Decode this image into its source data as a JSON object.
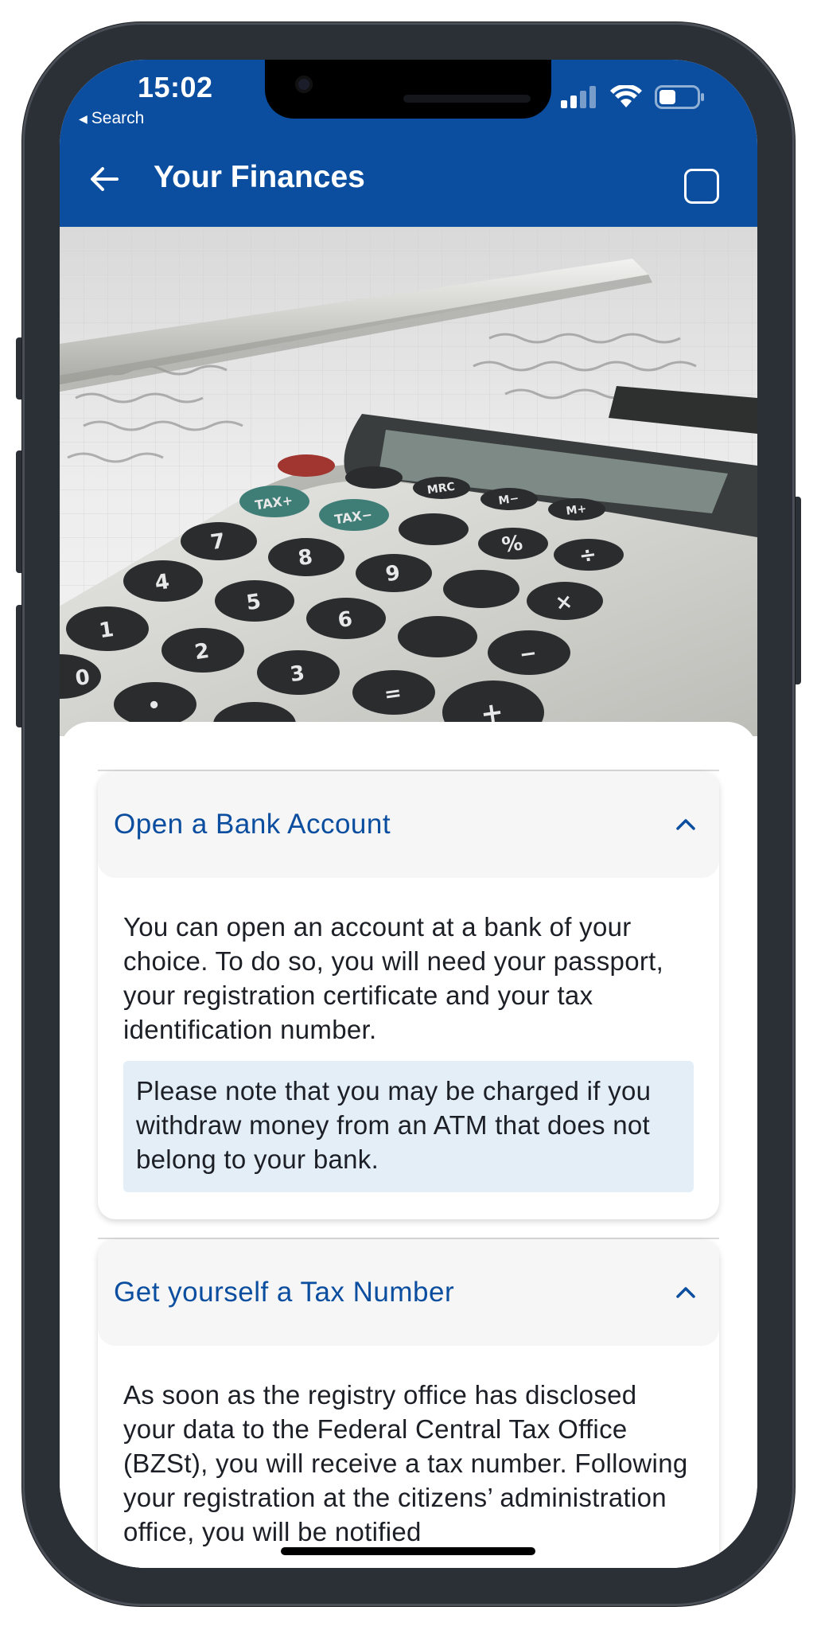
{
  "status_bar": {
    "time": "15:02",
    "back_label": "Search",
    "icons": [
      "cellular-signal-icon",
      "wifi-icon",
      "battery-icon"
    ]
  },
  "appbar": {
    "title": "Your Finances",
    "back_icon": "arrow-left-icon",
    "action_icon": "square-outline-icon",
    "color": "#0b4e9f"
  },
  "hero": {
    "description_icon": "calculator-illustration",
    "keys": [
      "TAX+",
      "TAX−",
      "MRC",
      "M−",
      "M+",
      "%",
      "÷",
      "×",
      "−",
      "+",
      "=",
      "7",
      "8",
      "9",
      "4",
      "5",
      "6",
      "1",
      "2",
      "3",
      "0",
      "•"
    ]
  },
  "sections": [
    {
      "title": "Open a Bank Account",
      "expanded": true,
      "chevron_icon": "chevron-up-icon",
      "body": "You can open an account at a bank of your choice. To do so, you will need your passport, your registration certificate and your tax identification number.",
      "note": "Please note that you may be charged if you withdraw money from an ATM that does not belong to your bank."
    },
    {
      "title": "Get yourself a Tax Number",
      "expanded": true,
      "chevron_icon": "chevron-up-icon",
      "body": "As soon as the registry office has disclosed your data to the Federal Central Tax Office (BZSt), you will receive a tax number. Following your registration at the citizens’ administration office, you will be notified"
    }
  ],
  "colors": {
    "accent": "#0b4e9f",
    "note_background": "#e4eef7",
    "header_background": "#f6f6f6"
  }
}
